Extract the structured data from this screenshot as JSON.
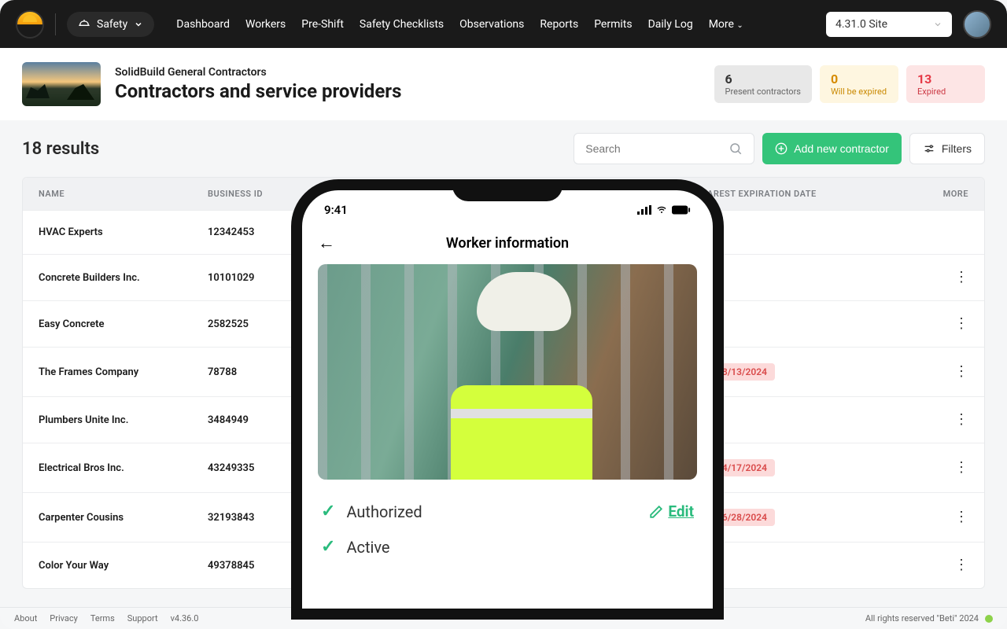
{
  "topnav": {
    "safety_label": "Safety",
    "links": [
      "Dashboard",
      "Workers",
      "Pre-Shift",
      "Safety Checklists",
      "Observations",
      "Reports",
      "Permits",
      "Daily Log"
    ],
    "more_label": "More",
    "site_selected": "4.31.0 Site"
  },
  "header": {
    "company": "SolidBuild General Contractors",
    "title": "Contractors and service providers"
  },
  "stats": [
    {
      "num": "6",
      "lbl": "Present contractors",
      "style": "gray"
    },
    {
      "num": "0",
      "lbl": "Will be expired",
      "style": "yellow"
    },
    {
      "num": "13",
      "lbl": "Expired",
      "style": "red"
    }
  ],
  "controls": {
    "results": "18 results",
    "search_placeholder": "Search",
    "add_label": "Add new contractor",
    "filters_label": "Filters"
  },
  "table": {
    "headers": {
      "name": "NAME",
      "bid": "BUSINESS ID",
      "exp": "NEAREST EXPIRATION DATE",
      "more": "MORE"
    },
    "rows": [
      {
        "name": "HVAC Experts",
        "bid": "12342453",
        "exp": "-",
        "badge": false,
        "showmore": false
      },
      {
        "name": "Concrete Builders Inc.",
        "bid": "10101029",
        "exp": "-",
        "badge": false,
        "showmore": true
      },
      {
        "name": "Easy Concrete",
        "bid": "2582525",
        "exp": "-",
        "badge": false,
        "showmore": true
      },
      {
        "name": "The Frames Company",
        "bid": "78788",
        "exp": "08/13/2024",
        "badge": true,
        "showmore": true
      },
      {
        "name": "Plumbers Unite Inc.",
        "bid": "3484949",
        "exp": "-",
        "badge": false,
        "showmore": true
      },
      {
        "name": "Electrical Bros Inc.",
        "bid": "43249335",
        "exp": "04/17/2024",
        "badge": true,
        "showmore": true
      },
      {
        "name": "Carpenter Cousins",
        "bid": "32193843",
        "exp": "06/28/2024",
        "badge": true,
        "showmore": true
      },
      {
        "name": "Color Your Way",
        "bid": "49378845",
        "exp": "-",
        "badge": false,
        "showmore": true
      }
    ]
  },
  "phone": {
    "time": "9:41",
    "title": "Worker information",
    "status_authorized": "Authorized",
    "status_autoactive": "Active",
    "edit_label": "Edit"
  },
  "footer": {
    "links": [
      "About",
      "Privacy",
      "Terms",
      "Support"
    ],
    "version": "v4.36.0",
    "copyright": "All rights reserved \"Beti\" 2024"
  },
  "colors": {
    "green": "#34c47a",
    "red": "#e63946",
    "yellow": "#d68b00"
  }
}
